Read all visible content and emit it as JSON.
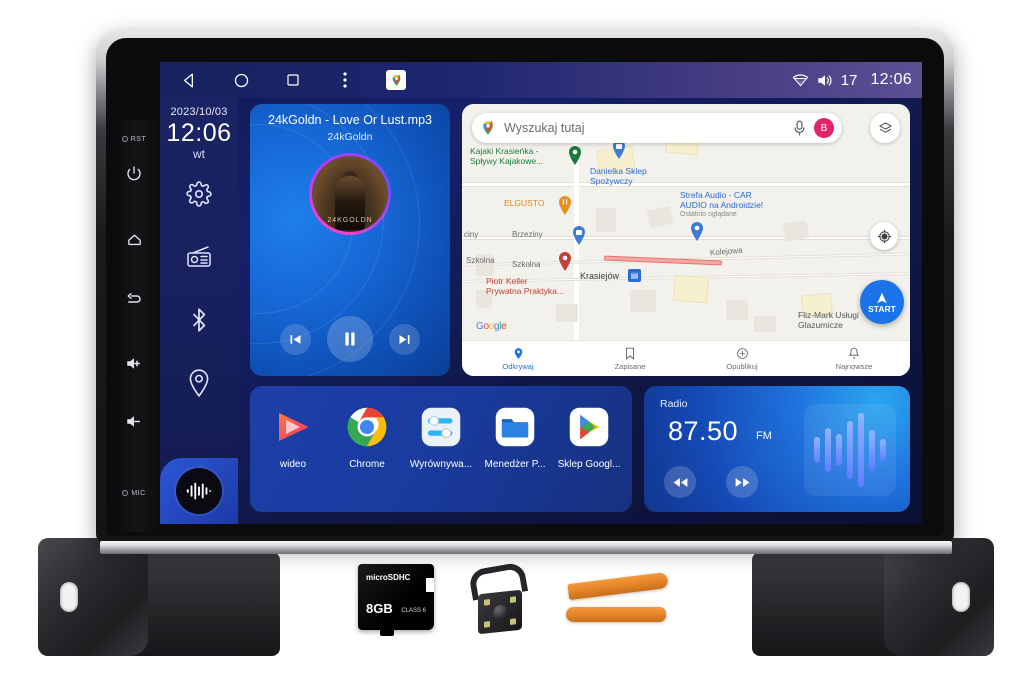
{
  "device": {
    "type": "car-head-unit",
    "side_keys": [
      {
        "name": "reset",
        "label": "RST"
      },
      {
        "name": "power",
        "label": ""
      },
      {
        "name": "home",
        "label": ""
      },
      {
        "name": "back",
        "label": ""
      },
      {
        "name": "volume-up",
        "label": ""
      },
      {
        "name": "volume-down",
        "label": ""
      },
      {
        "name": "microphone",
        "label": "MIC"
      }
    ]
  },
  "statusbar": {
    "back_label": "back",
    "home_label": "home",
    "recents_label": "recents",
    "menu_label": "menu",
    "app_shortcut_label": "Maps",
    "wifi_label": "wifi",
    "volume_value": "17",
    "clock": "12:06"
  },
  "dock": {
    "date": "2023/10/03",
    "time": "12:06",
    "day_of_week": "wt",
    "items": [
      {
        "name": "settings",
        "icon": "gear-icon"
      },
      {
        "name": "radio",
        "icon": "radio-icon"
      },
      {
        "name": "bluetooth",
        "icon": "bluetooth-icon"
      },
      {
        "name": "navigation",
        "icon": "location-pin-icon"
      }
    ],
    "assistant_label": "voice-assistant"
  },
  "music": {
    "title": "24kGoldn - Love Or Lust.mp3",
    "artist": "24kGoldn",
    "album_art_text": "24KGOLDN",
    "prev_label": "previous",
    "play_pause_label": "pause",
    "next_label": "next",
    "state": "playing"
  },
  "maps": {
    "search_placeholder": "Wyszukaj tutaj",
    "mic_label": "mic",
    "avatar_initial": "B",
    "layers_label": "layers",
    "recenter_label": "recenter",
    "start_button": "START",
    "watermark": "Google",
    "pois": [
      {
        "name": "Kajaki Krasieńka -\nSpływy Kajakowe...",
        "color": "#1a7a3c"
      },
      {
        "name": "Danielka Sklep\nSpożywczy",
        "color": "#2a6bd6"
      },
      {
        "name": "Strefa Audio - CAR\nAUDIO na Androidzie!",
        "sub": "Ostatnio oglądane",
        "color": "#2a6bd6"
      },
      {
        "name": "ELGUSTO",
        "color": "#d98a1f"
      },
      {
        "name": "Piotr Keller\nPrywatna Praktyka...",
        "color": "#c2413a"
      },
      {
        "name": "Fliz-Mark Usługi\nGlazurnicze",
        "color": "#555555"
      },
      {
        "name": "Krasiejów",
        "color": "#3c4043"
      }
    ],
    "streets": [
      "Brzeziny",
      "Szkolna",
      "Szkolna",
      "Kolejowa",
      "ciny"
    ],
    "bottom_nav": [
      {
        "label": "Odkrywaj",
        "icon": "location-pin-icon",
        "active": true
      },
      {
        "label": "Zapisane",
        "icon": "bookmark-icon",
        "active": false
      },
      {
        "label": "Opublikuj",
        "icon": "plus-circle-icon",
        "active": false
      },
      {
        "label": "Najnowsze",
        "icon": "bell-icon",
        "active": false
      }
    ]
  },
  "apps": [
    {
      "label": "wideo",
      "icon": "video-player-icon"
    },
    {
      "label": "Chrome",
      "icon": "chrome-icon"
    },
    {
      "label": "Wyrównywa...",
      "icon": "equalizer-icon"
    },
    {
      "label": "Menedżer P...",
      "icon": "file-manager-icon"
    },
    {
      "label": "Sklep Googl...",
      "icon": "play-store-icon"
    }
  ],
  "radio": {
    "title": "Radio",
    "frequency": "87.50",
    "band": "FM",
    "seek_down_label": "seek-down",
    "seek_up_label": "seek-up",
    "visualizer_label": "audio-visualizer"
  },
  "accessories": [
    {
      "name": "microsd-card",
      "label": "8GB",
      "brand": "microSDHC",
      "sub": "CLASS 6"
    },
    {
      "name": "rear-view-camera",
      "label": ""
    },
    {
      "name": "pry-tool",
      "label": ""
    },
    {
      "name": "pry-tool",
      "label": ""
    },
    {
      "name": "mounting-bracket-left",
      "label": ""
    },
    {
      "name": "mounting-bracket-right",
      "label": ""
    }
  ],
  "colors": {
    "accent_blue": "#1a73e8",
    "screen_bg": "#101a52",
    "card_blue": "#1668d6",
    "status_purple": "#5b4f95",
    "pry_orange": "#e8862a"
  }
}
